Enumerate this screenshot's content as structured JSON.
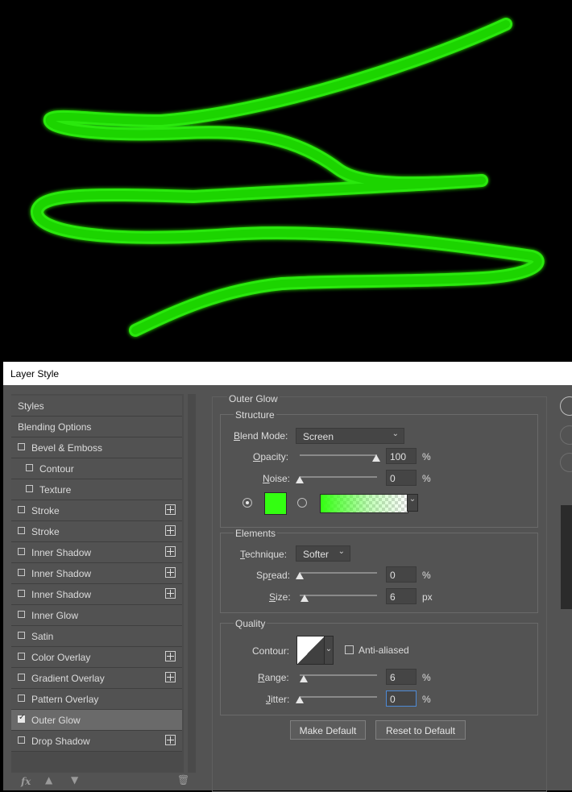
{
  "dialog": {
    "title": "Layer Style"
  },
  "styles_list": {
    "header_styles": "Styles",
    "header_blending": "Blending Options",
    "items": [
      {
        "label": "Bevel & Emboss",
        "checked": false,
        "plus": false,
        "indent": false
      },
      {
        "label": "Contour",
        "checked": false,
        "plus": false,
        "indent": true
      },
      {
        "label": "Texture",
        "checked": false,
        "plus": false,
        "indent": true
      },
      {
        "label": "Stroke",
        "checked": false,
        "plus": true,
        "indent": false
      },
      {
        "label": "Stroke",
        "checked": false,
        "plus": true,
        "indent": false
      },
      {
        "label": "Inner Shadow",
        "checked": false,
        "plus": true,
        "indent": false
      },
      {
        "label": "Inner Shadow",
        "checked": false,
        "plus": true,
        "indent": false
      },
      {
        "label": "Inner Shadow",
        "checked": false,
        "plus": true,
        "indent": false
      },
      {
        "label": "Inner Glow",
        "checked": false,
        "plus": false,
        "indent": false
      },
      {
        "label": "Satin",
        "checked": false,
        "plus": false,
        "indent": false
      },
      {
        "label": "Color Overlay",
        "checked": false,
        "plus": true,
        "indent": false
      },
      {
        "label": "Gradient Overlay",
        "checked": false,
        "plus": true,
        "indent": false
      },
      {
        "label": "Pattern Overlay",
        "checked": false,
        "plus": false,
        "indent": false
      },
      {
        "label": "Outer Glow",
        "checked": true,
        "plus": false,
        "indent": false,
        "selected": true
      },
      {
        "label": "Drop Shadow",
        "checked": false,
        "plus": true,
        "indent": false
      }
    ],
    "tools": {
      "fx": "fx",
      "up": "up-arrow-icon",
      "down": "down-arrow-icon",
      "trash": "trash-icon"
    }
  },
  "outer_glow": {
    "section_title": "Outer Glow",
    "structure": {
      "title": "Structure",
      "blend_mode": {
        "label_pre": "B",
        "label_rest": "lend Mode:",
        "value": "Screen"
      },
      "opacity": {
        "label_pre": "O",
        "label_rest": "pacity:",
        "value": "100",
        "unit": "%",
        "fraction": 1.0
      },
      "noise": {
        "label_pre": "N",
        "label_rest": "oise:",
        "value": "0",
        "unit": "%",
        "fraction": 0.0
      },
      "glow_color": "#33ff11",
      "gradient_colors": [
        "#33ff11",
        "#ffffff"
      ]
    },
    "elements": {
      "title": "Elements",
      "technique": {
        "label_pre": "T",
        "label_rest": "echnique:",
        "value": "Softer"
      },
      "spread": {
        "label_pre": "Sp",
        "label_u": "r",
        "label_rest": "ead:",
        "value": "0",
        "unit": "%",
        "fraction": 0.0
      },
      "size": {
        "label_pre": "S",
        "label_rest": "ize:",
        "value": "6",
        "unit": "px",
        "fraction": 0.04
      }
    },
    "quality": {
      "title": "Quality",
      "contour": {
        "label": "Contour:"
      },
      "anti_aliased": {
        "label": "Anti-aliased",
        "checked": false
      },
      "range": {
        "label_pre": "R",
        "label_rest": "ange:",
        "value": "6",
        "unit": "%",
        "fraction": 0.04
      },
      "jitter": {
        "label_pre": "J",
        "label_rest": "itter:",
        "value": "0",
        "unit": "%",
        "fraction": 0.0
      }
    },
    "buttons": {
      "make_default": "Make Default",
      "reset_default": "Reset to Default"
    }
  },
  "colors": {
    "glow": "#22dd00",
    "glow_edge": "#66ff44",
    "panel": "#535353"
  }
}
